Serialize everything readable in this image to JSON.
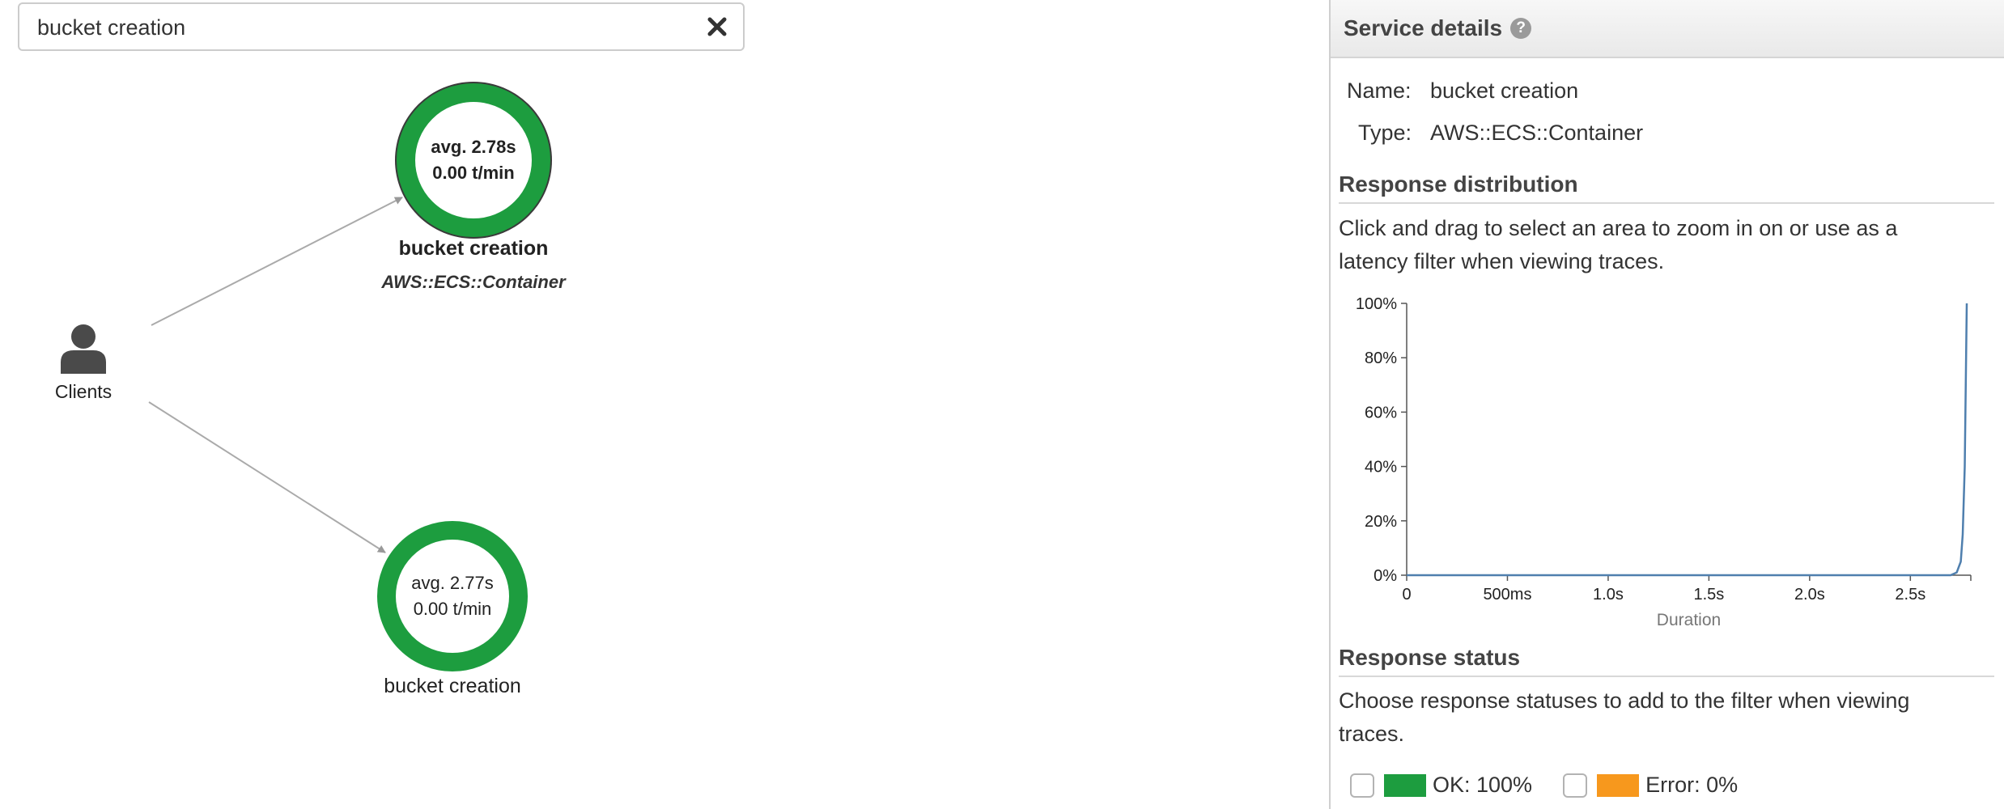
{
  "search": {
    "value": "bucket creation"
  },
  "clients": {
    "label": "Clients"
  },
  "nodes": [
    {
      "avg": "avg. 2.78s",
      "rate": "0.00 t/min",
      "label": "bucket creation",
      "type": "AWS::ECS::Container"
    },
    {
      "avg": "avg. 2.77s",
      "rate": "0.00 t/min",
      "label": "bucket creation"
    }
  ],
  "panel": {
    "title": "Service details",
    "name_key": "Name:",
    "name_value": "bucket creation",
    "type_key": "Type:",
    "type_value": "AWS::ECS::Container",
    "response_distribution_title": "Response distribution",
    "response_distribution_help_line1": "Click and drag to select an area to zoom in on or use as a",
    "response_distribution_help_line2": "latency filter when viewing traces.",
    "response_status_title": "Response status",
    "response_status_help_line1": "Choose response statuses to add to the filter when viewing",
    "response_status_help_line2": "traces.",
    "statuses": [
      {
        "label": "OK: 100%",
        "color": "#1d9d3f"
      },
      {
        "label": "Error: 0%",
        "color": "#f7981d"
      }
    ]
  },
  "colors": {
    "node_ok": "#1d9d3f",
    "line": "#4f7fae",
    "error": "#f7981d"
  },
  "chart_data": {
    "type": "line",
    "xlabel": "Duration",
    "ylabel": "",
    "xlim": [
      0,
      2.8
    ],
    "ylim": [
      0,
      100
    ],
    "x_ticks": [
      "0",
      "500ms",
      "1.0s",
      "1.5s",
      "2.0s",
      "2.5s"
    ],
    "x_tick_values": [
      0,
      0.5,
      1.0,
      1.5,
      2.0,
      2.5
    ],
    "y_ticks": [
      "0%",
      "20%",
      "40%",
      "60%",
      "80%",
      "100%"
    ],
    "y_tick_values": [
      0,
      20,
      40,
      60,
      80,
      100
    ],
    "series": [
      {
        "x": [
          0,
          2.5,
          2.7,
          2.73,
          2.75,
          2.76,
          2.77,
          2.78
        ],
        "y": [
          0,
          0,
          0,
          1,
          5,
          15,
          40,
          100
        ]
      }
    ]
  }
}
